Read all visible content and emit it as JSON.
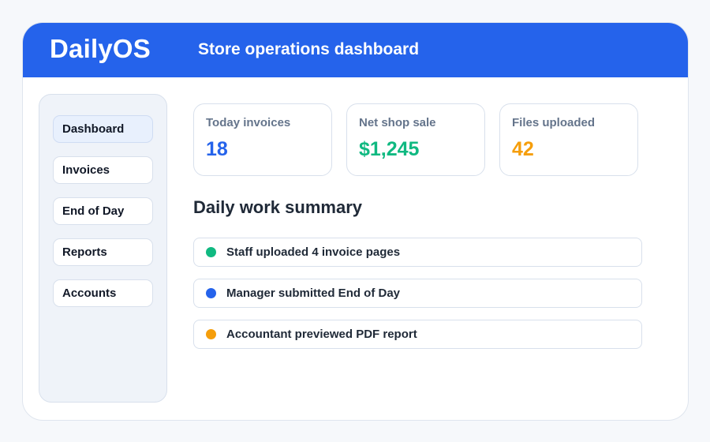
{
  "app": {
    "brand": "DailyOS",
    "subtitle": "Store operations dashboard",
    "accent_color": "#2563eb"
  },
  "sidebar": {
    "items": [
      {
        "label": "Dashboard",
        "active": true
      },
      {
        "label": "Invoices",
        "active": false
      },
      {
        "label": "End of Day",
        "active": false
      },
      {
        "label": "Reports",
        "active": false
      },
      {
        "label": "Accounts",
        "active": false
      }
    ]
  },
  "stats": [
    {
      "label": "Today invoices",
      "value": "18",
      "color": "#2563eb"
    },
    {
      "label": "Net shop sale",
      "value": "$1,245",
      "color": "#10b981"
    },
    {
      "label": "Files uploaded",
      "value": "42",
      "color": "#f59e0b"
    }
  ],
  "summary": {
    "title": "Daily work summary",
    "items": [
      {
        "text": "Staff uploaded 4 invoice pages",
        "dot_color": "#10b981"
      },
      {
        "text": "Manager submitted End of Day",
        "dot_color": "#2563eb"
      },
      {
        "text": "Accountant previewed PDF report",
        "dot_color": "#f59e0b"
      }
    ]
  }
}
